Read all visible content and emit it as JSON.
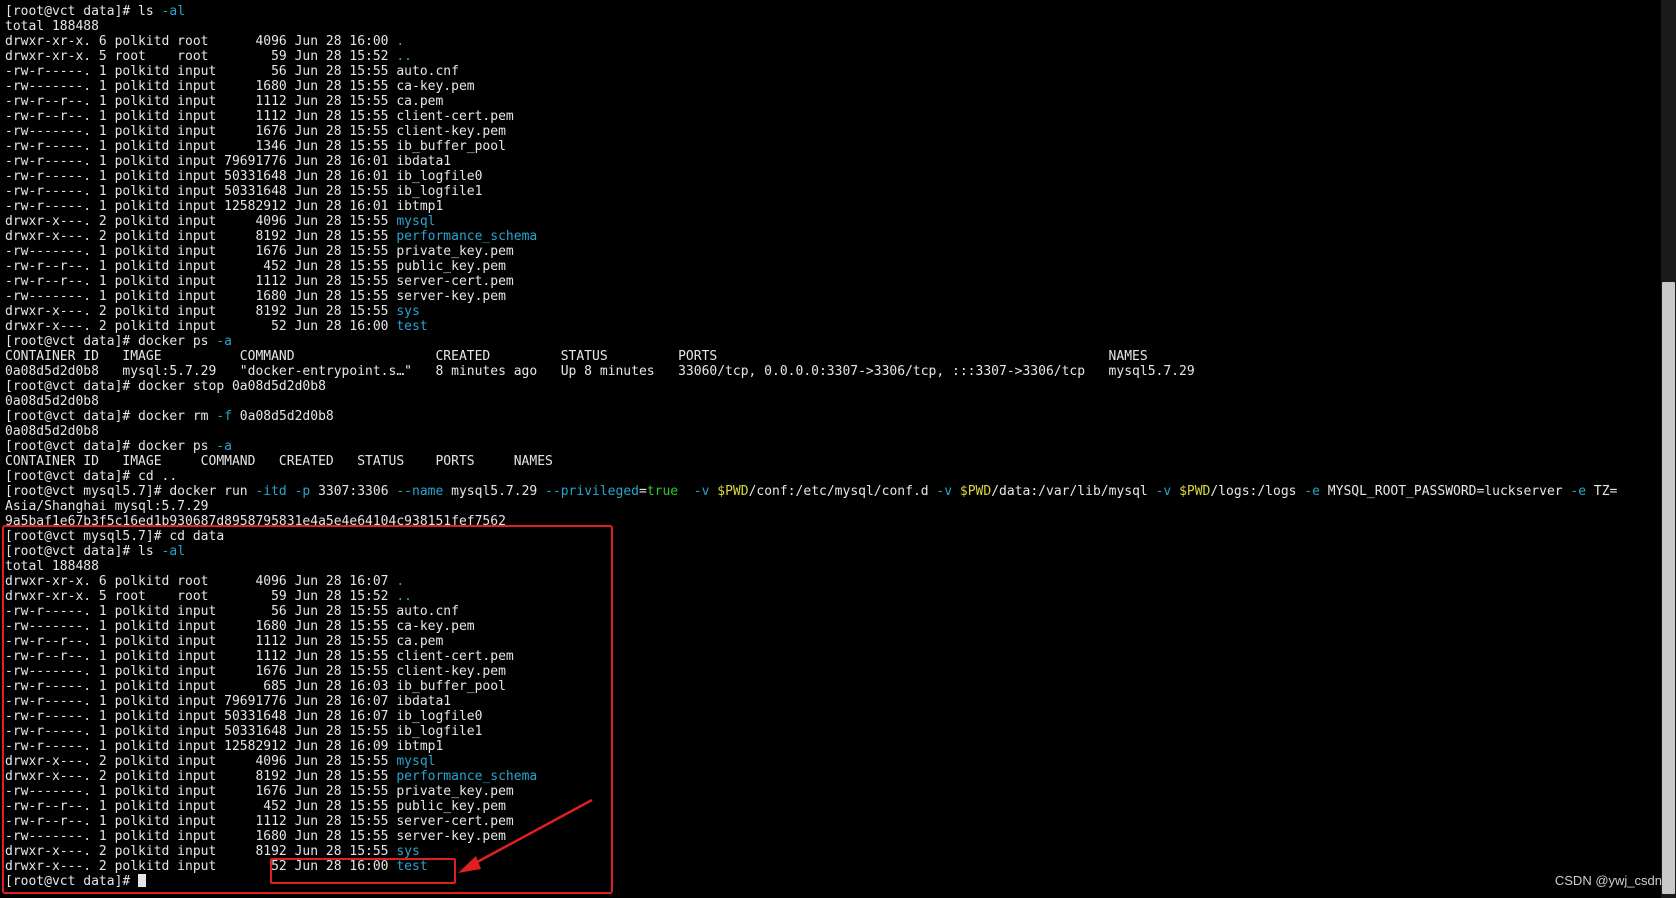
{
  "colors": {
    "background": "#000000",
    "text": "#e6e6e6",
    "directory": "#29a3cc",
    "option": "#29a3cc",
    "variable": "#d8d83a",
    "value": "#2ec72e",
    "annotation": "#e02020"
  },
  "watermark": "CSDN @ywj_csdn",
  "lines": [
    [
      {
        "t": "[root@vct data]# ls "
      },
      {
        "t": "-al",
        "c": "opt"
      }
    ],
    [
      {
        "t": "total 188488"
      }
    ],
    [
      {
        "t": "drwxr-xr-x. 6 polkitd root      4096 Jun 28 16:00 "
      },
      {
        "t": ".",
        "c": "dir"
      }
    ],
    [
      {
        "t": "drwxr-xr-x. 5 root    root        59 Jun 28 15:52 "
      },
      {
        "t": "..",
        "c": "dir"
      }
    ],
    [
      {
        "t": "-rw-r-----. 1 polkitd input       56 Jun 28 15:55 auto.cnf"
      }
    ],
    [
      {
        "t": "-rw-------. 1 polkitd input     1680 Jun 28 15:55 ca-key.pem"
      }
    ],
    [
      {
        "t": "-rw-r--r--. 1 polkitd input     1112 Jun 28 15:55 ca.pem"
      }
    ],
    [
      {
        "t": "-rw-r--r--. 1 polkitd input     1112 Jun 28 15:55 client-cert.pem"
      }
    ],
    [
      {
        "t": "-rw-------. 1 polkitd input     1676 Jun 28 15:55 client-key.pem"
      }
    ],
    [
      {
        "t": "-rw-r-----. 1 polkitd input     1346 Jun 28 15:55 ib_buffer_pool"
      }
    ],
    [
      {
        "t": "-rw-r-----. 1 polkitd input 79691776 Jun 28 16:01 ibdata1"
      }
    ],
    [
      {
        "t": "-rw-r-----. 1 polkitd input 50331648 Jun 28 16:01 ib_logfile0"
      }
    ],
    [
      {
        "t": "-rw-r-----. 1 polkitd input 50331648 Jun 28 15:55 ib_logfile1"
      }
    ],
    [
      {
        "t": "-rw-r-----. 1 polkitd input 12582912 Jun 28 16:01 ibtmp1"
      }
    ],
    [
      {
        "t": "drwxr-x---. 2 polkitd input     4096 Jun 28 15:55 "
      },
      {
        "t": "mysql",
        "c": "dir"
      }
    ],
    [
      {
        "t": "drwxr-x---. 2 polkitd input     8192 Jun 28 15:55 "
      },
      {
        "t": "performance_schema",
        "c": "dir"
      }
    ],
    [
      {
        "t": "-rw-------. 1 polkitd input     1676 Jun 28 15:55 private_key.pem"
      }
    ],
    [
      {
        "t": "-rw-r--r--. 1 polkitd input      452 Jun 28 15:55 public_key.pem"
      }
    ],
    [
      {
        "t": "-rw-r--r--. 1 polkitd input     1112 Jun 28 15:55 server-cert.pem"
      }
    ],
    [
      {
        "t": "-rw-------. 1 polkitd input     1680 Jun 28 15:55 server-key.pem"
      }
    ],
    [
      {
        "t": "drwxr-x---. 2 polkitd input     8192 Jun 28 15:55 "
      },
      {
        "t": "sys",
        "c": "dir"
      }
    ],
    [
      {
        "t": "drwxr-x---. 2 polkitd input       52 Jun 28 16:00 "
      },
      {
        "t": "test",
        "c": "dir"
      }
    ],
    [
      {
        "t": "[root@vct data]# docker ps "
      },
      {
        "t": "-a",
        "c": "opt"
      }
    ],
    [
      {
        "t": "CONTAINER ID   IMAGE          COMMAND                  CREATED         STATUS         PORTS                                                  NAMES"
      }
    ],
    [
      {
        "t": "0a08d5d2d0b8   mysql:5.7.29   \"docker-entrypoint.s…\"   8 minutes ago   Up 8 minutes   33060/tcp, 0.0.0.0:3307->3306/tcp, :::3307->3306/tcp   mysql5.7.29"
      }
    ],
    [
      {
        "t": "[root@vct data]# docker stop 0a08d5d2d0b8"
      }
    ],
    [
      {
        "t": "0a08d5d2d0b8"
      }
    ],
    [
      {
        "t": "[root@vct data]# docker rm "
      },
      {
        "t": "-f",
        "c": "opt"
      },
      {
        "t": " 0a08d5d2d0b8"
      }
    ],
    [
      {
        "t": "0a08d5d2d0b8"
      }
    ],
    [
      {
        "t": "[root@vct data]# docker ps "
      },
      {
        "t": "-a",
        "c": "opt"
      }
    ],
    [
      {
        "t": "CONTAINER ID   IMAGE     COMMAND   CREATED   STATUS    PORTS     NAMES"
      }
    ],
    [
      {
        "t": "[root@vct data]# cd .."
      }
    ],
    [
      {
        "t": "[root@vct mysql5.7]# docker run "
      },
      {
        "t": "-itd",
        "c": "opt"
      },
      {
        "t": " "
      },
      {
        "t": "-p",
        "c": "opt"
      },
      {
        "t": " 3307:3306 "
      },
      {
        "t": "--name",
        "c": "opt"
      },
      {
        "t": " mysql5.7.29 "
      },
      {
        "t": "--privileged",
        "c": "opt"
      },
      {
        "t": "="
      },
      {
        "t": "true",
        "c": "val"
      },
      {
        "t": "  "
      },
      {
        "t": "-v",
        "c": "opt"
      },
      {
        "t": " "
      },
      {
        "t": "$PWD",
        "c": "var"
      },
      {
        "t": "/conf:/etc/mysql/conf.d "
      },
      {
        "t": "-v",
        "c": "opt"
      },
      {
        "t": " "
      },
      {
        "t": "$PWD",
        "c": "var"
      },
      {
        "t": "/data:/var/lib/mysql "
      },
      {
        "t": "-v",
        "c": "opt"
      },
      {
        "t": " "
      },
      {
        "t": "$PWD",
        "c": "var"
      },
      {
        "t": "/logs:/logs "
      },
      {
        "t": "-e",
        "c": "opt"
      },
      {
        "t": " MYSQL_ROOT_PASSWORD=luckserver "
      },
      {
        "t": "-e",
        "c": "opt"
      },
      {
        "t": " TZ="
      }
    ],
    [
      {
        "t": "Asia/Shanghai mysql:5.7.29"
      }
    ],
    [
      {
        "t": "9a5baf1e67b3f5c16ed1b930687d8958795831e4a5e4e64104c938151fef7562"
      }
    ],
    [
      {
        "t": "[root@vct mysql5.7]# cd data"
      }
    ],
    [
      {
        "t": "[root@vct data]# ls "
      },
      {
        "t": "-al",
        "c": "opt"
      }
    ],
    [
      {
        "t": "total 188488"
      }
    ],
    [
      {
        "t": "drwxr-xr-x. 6 polkitd root      4096 Jun 28 16:07 "
      },
      {
        "t": ".",
        "c": "dir"
      }
    ],
    [
      {
        "t": "drwxr-xr-x. 5 root    root        59 Jun 28 15:52 "
      },
      {
        "t": "..",
        "c": "dir"
      }
    ],
    [
      {
        "t": "-rw-r-----. 1 polkitd input       56 Jun 28 15:55 auto.cnf"
      }
    ],
    [
      {
        "t": "-rw-------. 1 polkitd input     1680 Jun 28 15:55 ca-key.pem"
      }
    ],
    [
      {
        "t": "-rw-r--r--. 1 polkitd input     1112 Jun 28 15:55 ca.pem"
      }
    ],
    [
      {
        "t": "-rw-r--r--. 1 polkitd input     1112 Jun 28 15:55 client-cert.pem"
      }
    ],
    [
      {
        "t": "-rw-------. 1 polkitd input     1676 Jun 28 15:55 client-key.pem"
      }
    ],
    [
      {
        "t": "-rw-r-----. 1 polkitd input      685 Jun 28 16:03 ib_buffer_pool"
      }
    ],
    [
      {
        "t": "-rw-r-----. 1 polkitd input 79691776 Jun 28 16:07 ibdata1"
      }
    ],
    [
      {
        "t": "-rw-r-----. 1 polkitd input 50331648 Jun 28 16:07 ib_logfile0"
      }
    ],
    [
      {
        "t": "-rw-r-----. 1 polkitd input 50331648 Jun 28 15:55 ib_logfile1"
      }
    ],
    [
      {
        "t": "-rw-r-----. 1 polkitd input 12582912 Jun 28 16:09 ibtmp1"
      }
    ],
    [
      {
        "t": "drwxr-x---. 2 polkitd input     4096 Jun 28 15:55 "
      },
      {
        "t": "mysql",
        "c": "dir"
      }
    ],
    [
      {
        "t": "drwxr-x---. 2 polkitd input     8192 Jun 28 15:55 "
      },
      {
        "t": "performance_schema",
        "c": "dir"
      }
    ],
    [
      {
        "t": "-rw-------. 1 polkitd input     1676 Jun 28 15:55 private_key.pem"
      }
    ],
    [
      {
        "t": "-rw-r--r--. 1 polkitd input      452 Jun 28 15:55 public_key.pem"
      }
    ],
    [
      {
        "t": "-rw-r--r--. 1 polkitd input     1112 Jun 28 15:55 server-cert.pem"
      }
    ],
    [
      {
        "t": "-rw-------. 1 polkitd input     1680 Jun 28 15:55 server-key.pem"
      }
    ],
    [
      {
        "t": "drwxr-x---. 2 polkitd input     8192 Jun 28 15:55 "
      },
      {
        "t": "sys",
        "c": "dir"
      }
    ],
    [
      {
        "t": "drwxr-x---. 2 polkitd input       52 Jun 28 16:00 "
      },
      {
        "t": "test",
        "c": "dir"
      }
    ],
    [
      {
        "t": "[root@vct data]# "
      },
      {
        "cursor": true
      }
    ]
  ]
}
